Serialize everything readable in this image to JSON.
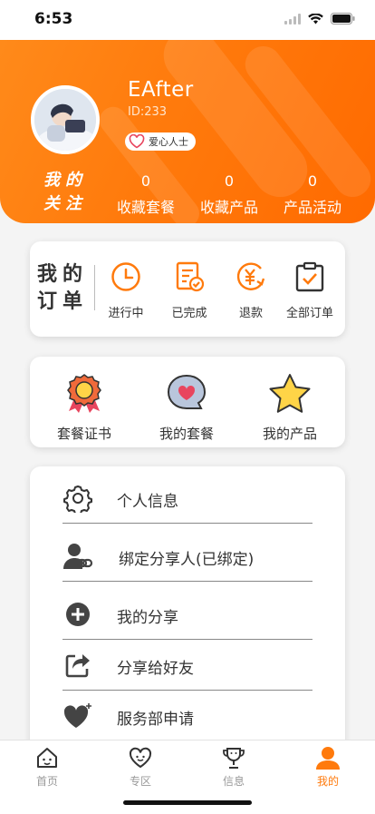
{
  "status_bar": {
    "time": "6:53"
  },
  "profile": {
    "name": "EAfter",
    "id_text": "ID:233",
    "badge": "爱心人士",
    "follow_label": "我的关注",
    "stats": [
      {
        "count": "0",
        "label": "收藏套餐"
      },
      {
        "count": "0",
        "label": "收藏产品"
      },
      {
        "count": "0",
        "label": "产品活动"
      }
    ]
  },
  "orders": {
    "title": "我的订单",
    "items": [
      {
        "label": "进行中",
        "icon": "clock-icon"
      },
      {
        "label": "已完成",
        "icon": "document-check-icon"
      },
      {
        "label": "退款",
        "icon": "yen-refund-icon"
      },
      {
        "label": "全部订单",
        "icon": "clipboard-check-icon"
      }
    ]
  },
  "packages": {
    "items": [
      {
        "label": "套餐证书",
        "icon": "medal-icon"
      },
      {
        "label": "我的套餐",
        "icon": "heart-bubble-icon"
      },
      {
        "label": "我的产品",
        "icon": "star-icon"
      }
    ]
  },
  "menu": {
    "items": [
      {
        "label": "个人信息",
        "icon": "gear-icon"
      },
      {
        "label": "绑定分享人(已绑定)",
        "icon": "user-link-icon"
      },
      {
        "label": "我的分享",
        "icon": "plus-circle-icon"
      },
      {
        "label": "分享给好友",
        "icon": "share-icon"
      },
      {
        "label": "服务部申请",
        "icon": "heart-plus-icon"
      }
    ]
  },
  "tabbar": {
    "items": [
      {
        "label": "首页",
        "icon": "home-icon"
      },
      {
        "label": "专区",
        "icon": "heart-face-icon"
      },
      {
        "label": "信息",
        "icon": "trophy-icon"
      },
      {
        "label": "我的",
        "icon": "user-icon"
      }
    ],
    "active_index": 3
  },
  "colors": {
    "accent": "#ff7a0c",
    "header_start": "#ff8a1a",
    "header_end": "#ff6a00"
  }
}
